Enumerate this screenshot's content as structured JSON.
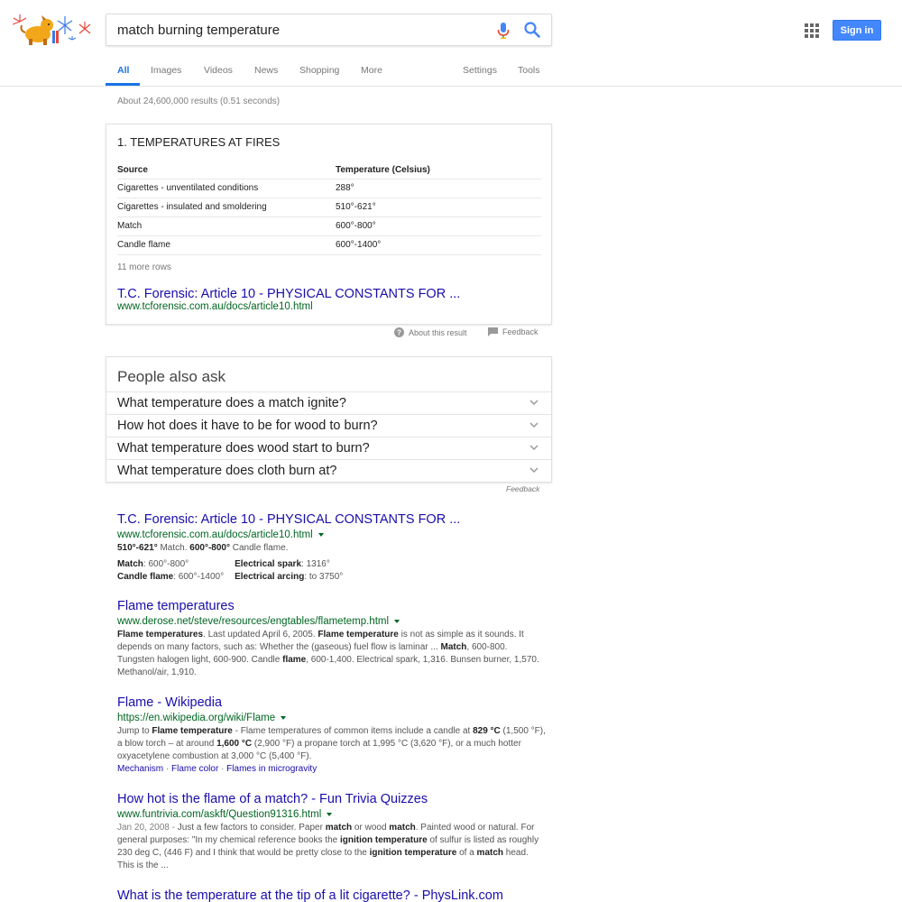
{
  "search": {
    "query": "match burning temperature",
    "signin_label": "Sign in"
  },
  "tabs": [
    {
      "label": "All",
      "active": true
    },
    {
      "label": "Images"
    },
    {
      "label": "Videos"
    },
    {
      "label": "News"
    },
    {
      "label": "Shopping"
    },
    {
      "label": "More"
    },
    {
      "label": "Settings"
    },
    {
      "label": "Tools"
    }
  ],
  "result_stats": "About 24,600,000 results (0.51 seconds)",
  "snippet": {
    "title": "1. TEMPERATURES AT FIRES",
    "headers": [
      "Source",
      "Temperature (Celsius)"
    ],
    "rows": [
      [
        "Cigarettes - unventilated conditions",
        "288°"
      ],
      [
        "Cigarettes - insulated and smoldering",
        "510°-621°"
      ],
      [
        "Match",
        "600°-800°"
      ],
      [
        "Candle flame",
        "600°-1400°"
      ]
    ],
    "more_rows": "11 more rows",
    "link": "T.C. Forensic: Article 10 - PHYSICAL CONSTANTS FOR ...",
    "url": "www.tcforensic.com.au/docs/article10.html",
    "about": "About this result",
    "feedback": "Feedback"
  },
  "paa": {
    "title": "People also ask",
    "questions": [
      "What temperature does a match ignite?",
      "How hot does it have to be for wood to burn?",
      "What temperature does wood start to burn?",
      "What temperature does cloth burn at?"
    ],
    "feedback": "Feedback"
  },
  "results": [
    {
      "title": "T.C. Forensic: Article 10 - PHYSICAL CONSTANTS FOR ...",
      "url": "www.tcforensic.com.au/docs/article10.html",
      "snippet_a": "510°-621°",
      "snippet_b": " Match. ",
      "snippet_c": "600°-800°",
      "snippet_d": " Candle flame.",
      "grid": {
        "c1a_label": "Match",
        "c1a_val": ": 600°-800°",
        "c1b_label": "Candle flame",
        "c1b_val": ": 600°-1400°",
        "c2a_label": "Electrical spark",
        "c2a_val": ": 1316°",
        "c2b_label": "Electrical arcing",
        "c2b_val": ": to 3750°"
      }
    },
    {
      "title": "Flame temperatures",
      "url": "www.derose.net/steve/resources/engtables/flametemp.html",
      "s1": "Flame temperatures",
      "s2": ". Last updated April 6, 2005. ",
      "s3": "Flame temperature",
      "s4": " is not as simple as it sounds. It depends on many factors, such as: Whether the (gaseous) fuel flow is laminar ... ",
      "s5": "Match",
      "s6": ", 600-800. Tungsten halogen light, 600-900. Candle ",
      "s7": "flame",
      "s8": ", 600-1,400. Electrical spark, 1,316. Bunsen burner, 1,570. Methanol/air, 1,910."
    },
    {
      "title": "Flame - Wikipedia",
      "url": "https://en.wikipedia.org/wiki/Flame",
      "s1": "Jump to ",
      "s2": "Flame temperature",
      "s3": " - Flame temperatures of common items include a candle at ",
      "s4": "829 °C",
      "s5": " (1,500 °F), a blow torch – at around ",
      "s6": "1,600 °C",
      "s7": " (2,900 °F) a propane torch at 1,995 °C (3,620 °F), or a much hotter oxyacetylene combustion at 3,000 °C (5,400 °F).",
      "sitelinks": [
        "Mechanism",
        "Flame color",
        "Flames in microgravity"
      ],
      "sep": " · "
    },
    {
      "title": "How hot is the flame of a match? - Fun Trivia Quizzes",
      "url": "www.funtrivia.com/askft/Question91316.html",
      "date": "Jan 20, 2008 - ",
      "s1": "Just a few factors to consider. Paper ",
      "s2": "match",
      "s3": " or wood ",
      "s4": "match",
      "s5": ". Painted wood or natural. For general purposes: \"In my chemical reference books the ",
      "s6": "ignition temperature",
      "s7": " of sulfur is listed as roughly 230 deg C, (446 F) and I think that would be pretty close to the ",
      "s8": "ignition temperature",
      "s9": " of a ",
      "s10": "match",
      "s11": " head. This is the ..."
    },
    {
      "title": "What is the temperature at the tip of a lit cigarette? - PhysLink.com"
    }
  ],
  "colors": {
    "link": "#1a0dab",
    "url": "#006621",
    "accent": "#1a73e8",
    "signin": "#4387fd"
  }
}
